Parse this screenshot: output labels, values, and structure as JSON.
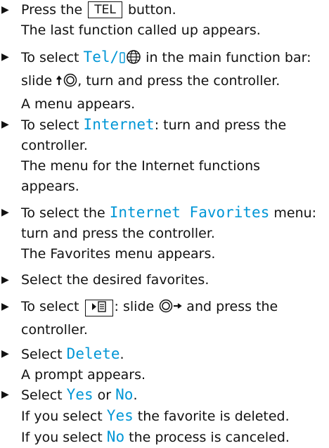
{
  "bullet_glyph": "▶",
  "accent_color": "#0096d6",
  "steps": [
    {
      "line1_pre": "Press the",
      "key_tel": "TEL",
      "line1_post": "button.",
      "line2": "The last function called up appears."
    },
    {
      "line1_pre": "To select",
      "menu_tel": "Tel/",
      "line1_post": "in the main function bar:",
      "line2_pre": "slide",
      "line2_post": ", turn and press the controller.",
      "line3": "A menu appears."
    },
    {
      "line1_pre": "To select",
      "menu_internet": "Internet",
      "line1_post": ": turn and press the",
      "line2": "controller.",
      "line3": "The menu for the Internet functions",
      "line4": "appears."
    },
    {
      "line1_pre": "To select the",
      "menu_favorites": "Internet Favorites",
      "line1_post": "menu:",
      "line2": "turn and press the controller.",
      "line3": "The Favorites menu appears."
    },
    {
      "line1": "Select the desired favorites."
    },
    {
      "line1_pre": "To select",
      "key_options_icon": "options-menu-icon",
      "line1_mid": ": slide",
      "line1_post": "and press the",
      "line2": "controller."
    },
    {
      "line1_pre": "Select",
      "menu_delete": "Delete",
      "line1_post": ".",
      "line2": "A prompt appears."
    },
    {
      "line1_pre": "Select",
      "opt_yes": "Yes",
      "line1_mid": "or",
      "opt_no": "No",
      "line1_post": ".",
      "line2_pre": "If you select",
      "line2_opt": "Yes",
      "line2_post": "the favorite is deleted.",
      "line3_pre": "If you select",
      "line3_opt": "No",
      "line3_post": "the process is canceled."
    }
  ]
}
